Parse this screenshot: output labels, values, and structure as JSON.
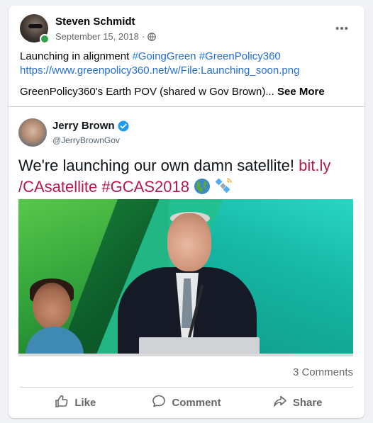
{
  "post": {
    "author_name": "Steven Schmidt",
    "date": "September 15, 2018",
    "separator": " · ",
    "privacy_icon": "globe-icon",
    "more_icon": "more-options-icon",
    "text_line1": "Launching in alignment",
    "hashtag1": "#GoingGreen",
    "hashtag2": "#GreenPolicy360",
    "link": "https://www.greenpolicy360.net/w/File:Launching_soon.png",
    "text_line3": "GreenPolicy360's Earth POV  (shared w Gov Brown)...",
    "see_more": "See More"
  },
  "tweet": {
    "name": "Jerry Brown",
    "handle": "@JerryBrownGov",
    "verified_icon": "verified-badge-icon",
    "text": "We're launching our own damn satellite!",
    "link_part1": "bit.ly",
    "link_part2": "/CAsatellite",
    "hashtag": "#GCAS2018",
    "emoji": [
      "globe-americas-emoji",
      "satellite-emoji"
    ],
    "video_progress": 0.0
  },
  "footer": {
    "comments_count": "3 Comments",
    "like_label": "Like",
    "comment_label": "Comment",
    "share_label": "Share"
  },
  "colors": {
    "link": "#216fdb",
    "tweet_link": "#b3194a",
    "online": "#31a24c",
    "muted": "#65676b"
  }
}
